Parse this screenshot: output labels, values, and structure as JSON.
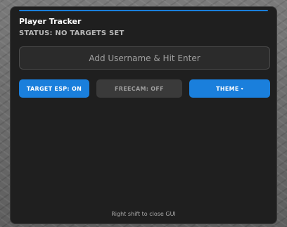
{
  "panel": {
    "title": "Player Tracker",
    "status": "STATUS: NO TARGETS SET",
    "accent_color": "#1a7fdc"
  },
  "input": {
    "placeholder": "Add Username & Hit Enter",
    "value": ""
  },
  "buttons": {
    "target_esp": "TARGET ESP: ON",
    "freecam": "FREECAM: OFF",
    "theme": "THEME",
    "theme_caret": "▾"
  },
  "footer": {
    "hint": "Right shift to close GUI"
  }
}
